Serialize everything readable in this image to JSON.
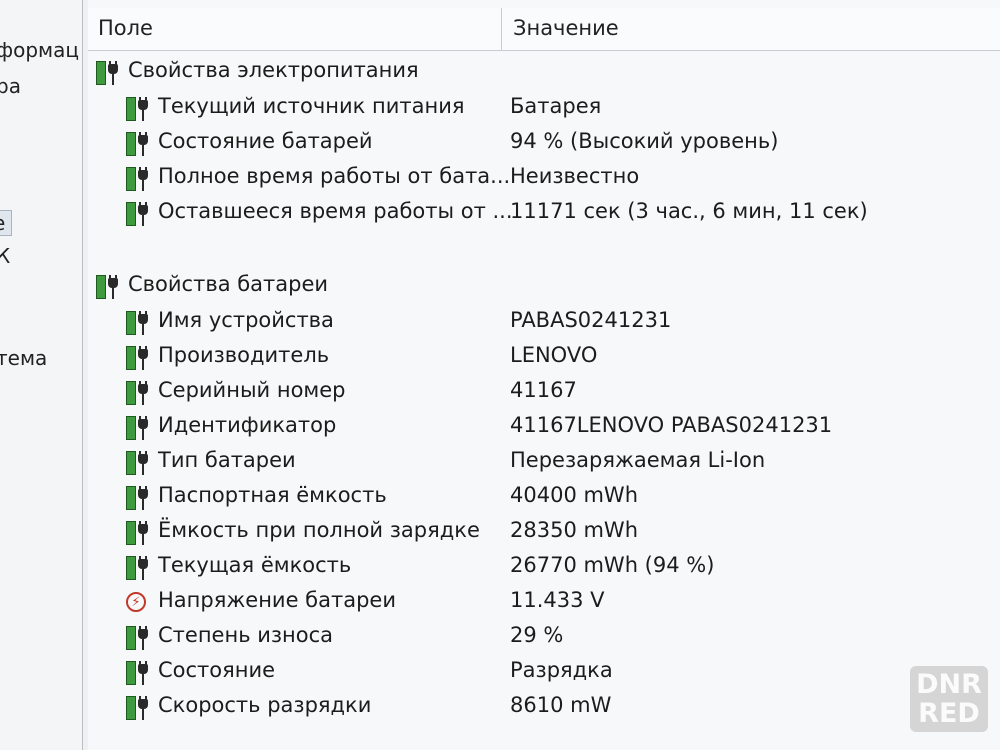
{
  "left_pane": {
    "items": [
      "формац",
      "ра",
      "е",
      "К",
      "тема"
    ]
  },
  "header": {
    "field": "Поле",
    "value": "Значение"
  },
  "groups": [
    {
      "title": "Свойства электропитания",
      "rows": [
        {
          "label": "Текущий источник питания",
          "value": "Батарея",
          "icon": "battery-plug-icon"
        },
        {
          "label": "Состояние батарей",
          "value": "94 % (Высокий уровень)",
          "icon": "battery-plug-icon"
        },
        {
          "label": "Полное время работы от бата...",
          "value": "Неизвестно",
          "icon": "battery-plug-icon"
        },
        {
          "label": "Оставшееся время работы от ...",
          "value": "11171 сек (3 час., 6 мин, 11 сек)",
          "icon": "battery-plug-icon"
        }
      ]
    },
    {
      "title": "Свойства батареи",
      "rows": [
        {
          "label": "Имя устройства",
          "value": "PABAS0241231",
          "icon": "battery-plug-icon"
        },
        {
          "label": "Производитель",
          "value": "LENOVO",
          "icon": "battery-plug-icon"
        },
        {
          "label": "Серийный номер",
          "value": "41167",
          "icon": "battery-plug-icon"
        },
        {
          "label": "Идентификатор",
          "value": "41167LENOVO PABAS0241231",
          "icon": "battery-plug-icon"
        },
        {
          "label": "Тип батареи",
          "value": "Перезаряжаемая Li-Ion",
          "icon": "battery-plug-icon"
        },
        {
          "label": "Паспортная ёмкость",
          "value": "40400 mWh",
          "icon": "battery-plug-icon"
        },
        {
          "label": "Ёмкость при полной зарядке",
          "value": "28350 mWh",
          "icon": "battery-plug-icon"
        },
        {
          "label": "Текущая ёмкость",
          "value": "26770 mWh  (94 %)",
          "icon": "battery-plug-icon"
        },
        {
          "label": "Напряжение батареи",
          "value": "11.433 V",
          "icon": "voltage-icon"
        },
        {
          "label": "Степень износа",
          "value": "29 %",
          "icon": "battery-plug-icon"
        },
        {
          "label": "Состояние",
          "value": "Разрядка",
          "icon": "battery-plug-icon"
        },
        {
          "label": "Скорость разрядки",
          "value": "8610 mW",
          "icon": "battery-plug-icon"
        }
      ]
    }
  ],
  "watermark": {
    "line1": "DNR",
    "line2": "RED"
  },
  "colors": {
    "battery_green": "#3f9a3f",
    "voltage_red": "#c0392b"
  }
}
